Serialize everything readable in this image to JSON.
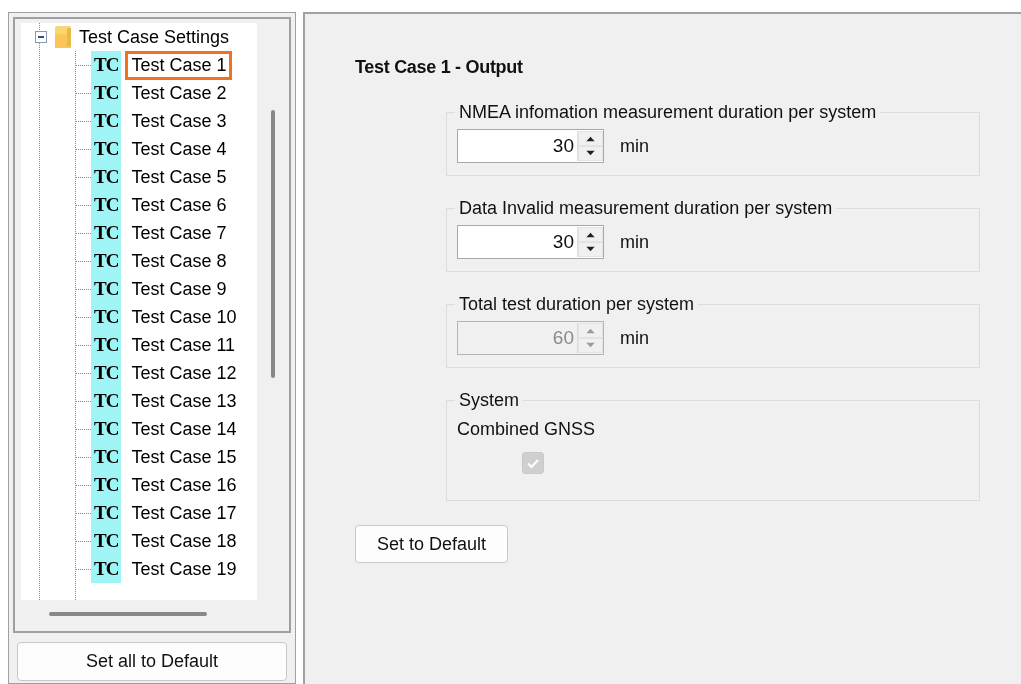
{
  "tree": {
    "root": {
      "label": "Test Case Settings",
      "expanded": true
    },
    "items": [
      {
        "badge": "TC",
        "label": "Test Case 1",
        "selected": true
      },
      {
        "badge": "TC",
        "label": "Test Case 2",
        "selected": false
      },
      {
        "badge": "TC",
        "label": "Test Case 3",
        "selected": false
      },
      {
        "badge": "TC",
        "label": "Test Case 4",
        "selected": false
      },
      {
        "badge": "TC",
        "label": "Test Case 5",
        "selected": false
      },
      {
        "badge": "TC",
        "label": "Test Case 6",
        "selected": false
      },
      {
        "badge": "TC",
        "label": "Test Case 7",
        "selected": false
      },
      {
        "badge": "TC",
        "label": "Test Case 8",
        "selected": false
      },
      {
        "badge": "TC",
        "label": "Test Case 9",
        "selected": false
      },
      {
        "badge": "TC",
        "label": "Test Case 10",
        "selected": false
      },
      {
        "badge": "TC",
        "label": "Test Case 11",
        "selected": false
      },
      {
        "badge": "TC",
        "label": "Test Case 12",
        "selected": false
      },
      {
        "badge": "TC",
        "label": "Test Case 13",
        "selected": false
      },
      {
        "badge": "TC",
        "label": "Test Case 14",
        "selected": false
      },
      {
        "badge": "TC",
        "label": "Test Case 15",
        "selected": false
      },
      {
        "badge": "TC",
        "label": "Test Case 16",
        "selected": false
      },
      {
        "badge": "TC",
        "label": "Test Case 17",
        "selected": false
      },
      {
        "badge": "TC",
        "label": "Test Case 18",
        "selected": false
      },
      {
        "badge": "TC",
        "label": "Test Case 19",
        "selected": false
      }
    ]
  },
  "left_button": "Set all to Default",
  "panel": {
    "title": "Test Case 1 - Output",
    "groups": [
      {
        "kind": "spinner",
        "title": "NMEA infomation measurement duration per system",
        "value": "30",
        "unit": "min",
        "disabled": false
      },
      {
        "kind": "spinner",
        "title": "Data Invalid measurement duration per system",
        "value": "30",
        "unit": "min",
        "disabled": false
      },
      {
        "kind": "spinner",
        "title": "Total test duration per system",
        "value": "60",
        "unit": "min",
        "disabled": true
      },
      {
        "kind": "checkbox",
        "title": "System",
        "label": "Combined GNSS",
        "checked": true,
        "disabled": true
      }
    ],
    "button": "Set to Default"
  }
}
